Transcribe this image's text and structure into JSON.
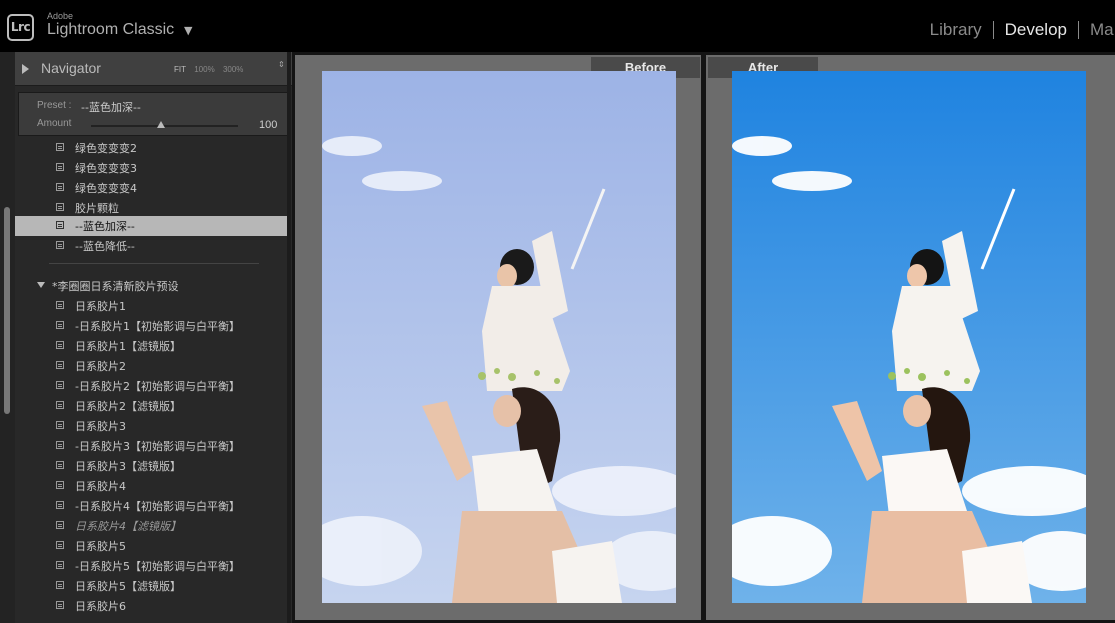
{
  "app": {
    "logo": "Lrc",
    "vendor": "Adobe",
    "name": "Lightroom Classic",
    "menu_caret": "▼"
  },
  "modules": [
    {
      "label": "Library",
      "active": false
    },
    {
      "label": "Develop",
      "active": true
    },
    {
      "label": "Ma",
      "active": false
    }
  ],
  "navigator": {
    "expand_glyph": "▶",
    "title": "Navigator",
    "zoom_options": [
      "FIT",
      "100%",
      "300%"
    ],
    "zoom_stepper": "⇕"
  },
  "preset_panel": {
    "preset_label": "Preset :",
    "preset_value": "--蓝色加深--",
    "amount_label": "Amount",
    "amount_value": "100"
  },
  "preset_items": [
    {
      "label": "绿色变变变2"
    },
    {
      "label": "绿色变变变3"
    },
    {
      "label": "绿色变变变4"
    },
    {
      "label": "胶片颗粒"
    },
    {
      "label": "--蓝色加深--",
      "selected": true
    },
    {
      "label": "--蓝色降低--"
    }
  ],
  "preset_group": {
    "label": "*李圈圈日系清新胶片预设",
    "items": [
      {
        "label": "日系胶片1"
      },
      {
        "label": "-日系胶片1【初始影调与白平衡】"
      },
      {
        "label": "日系胶片1【滤镜版】"
      },
      {
        "label": "日系胶片2"
      },
      {
        "label": "-日系胶片2【初始影调与白平衡】"
      },
      {
        "label": "日系胶片2【滤镜版】"
      },
      {
        "label": "日系胶片3"
      },
      {
        "label": "-日系胶片3【初始影调与白平衡】"
      },
      {
        "label": "日系胶片3【滤镜版】"
      },
      {
        "label": "日系胶片4"
      },
      {
        "label": "-日系胶片4【初始影调与白平衡】"
      },
      {
        "label": "日系胶片4【滤镜版】",
        "italic": true
      },
      {
        "label": "日系胶片5"
      },
      {
        "label": "-日系胶片5【初始影调与白平衡】"
      },
      {
        "label": "日系胶片5【滤镜版】"
      },
      {
        "label": "日系胶片6"
      }
    ]
  },
  "compare": {
    "before_label": "Before",
    "after_label": "After"
  },
  "colors": {
    "before_sky_top": "#9db3e6",
    "before_sky_bottom": "#c6d4ef",
    "after_sky_top": "#1f83e0",
    "after_sky_bottom": "#6fb2ea",
    "selected_row": "#b7b7b7"
  }
}
